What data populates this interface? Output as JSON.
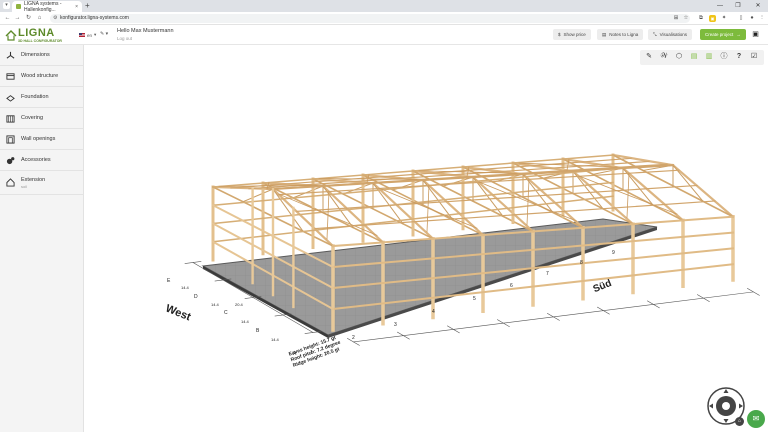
{
  "browser": {
    "tab_title": "LIGNA systems - Hallenkonfig...",
    "tab_close": "×",
    "new_tab": "+",
    "url": "konfigurator.ligna-systems.com",
    "window_controls": [
      "—",
      "❐",
      "✕"
    ]
  },
  "header": {
    "logo_word": "LIGNA",
    "logo_sub": "3D HALL CONFIGURATOR",
    "language_code": "en",
    "greeting": "Hello Max Mustermann",
    "logout": "Log out",
    "buttons": {
      "show_price": "Show price",
      "notes": "Notes to Ligna",
      "visualisations": "Visualisations",
      "create_project": "Create project"
    },
    "accent_color": "#7dbb3c"
  },
  "sidebar": {
    "items": [
      {
        "label": "Dimensions",
        "icon": "dimensions-icon"
      },
      {
        "label": "Wood structure",
        "icon": "wood-structure-icon"
      },
      {
        "label": "Foundation",
        "icon": "foundation-icon"
      },
      {
        "label": "Covering",
        "icon": "covering-icon"
      },
      {
        "label": "Wall openings",
        "icon": "wall-openings-icon"
      },
      {
        "label": "Accessories",
        "icon": "accessories-icon"
      },
      {
        "label": "Extension",
        "sub": "soil",
        "icon": "extension-icon"
      }
    ]
  },
  "toolbar": {
    "tools": [
      "pen-icon",
      "signature-icon",
      "cube-icon",
      "layer-icon",
      "layer-outline-icon",
      "info-icon",
      "help-icon",
      "checklist-icon"
    ],
    "help_glyph": "?"
  },
  "scene": {
    "west_label": "West",
    "south_label": "Süd",
    "axis_letters": [
      "A",
      "B",
      "C",
      "D",
      "E"
    ],
    "axis_numbers": [
      "1",
      "2",
      "3",
      "4",
      "5",
      "6",
      "7",
      "8",
      "9"
    ],
    "info_lines": [
      "Eaves height: 15.7 gt",
      "Roof pitch: 7.2 degree",
      "Ridge height: 20.5 gt"
    ],
    "segment_labels": [
      "14.4",
      "14.4",
      "14.4",
      "14.4",
      "20.4"
    ]
  }
}
